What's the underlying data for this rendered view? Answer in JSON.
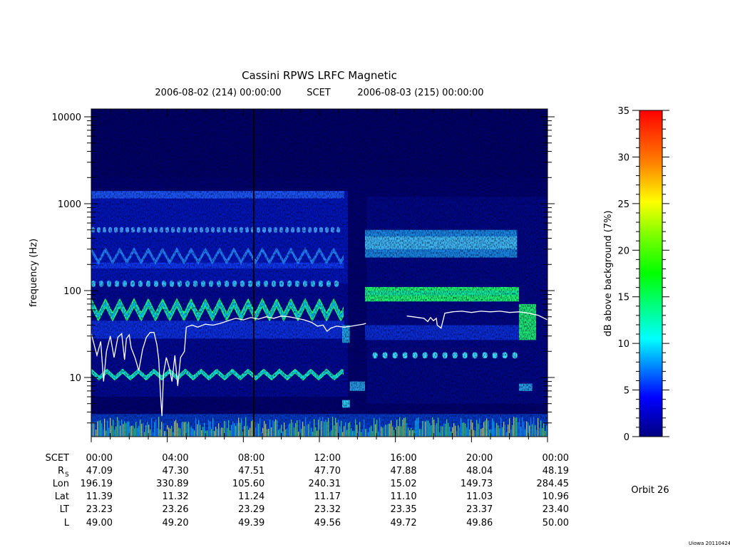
{
  "chart_data": {
    "type": "heatmap",
    "title": "Cassini RPWS LRFC Magnetic",
    "subtitle": {
      "start": "2006-08-02 (214) 00:00:00",
      "frame": "SCET",
      "end": "2006-08-03 (215) 00:00:00"
    },
    "ylabel": "frequency (Hz)",
    "y_scale": "log",
    "y_ticks": [
      {
        "value": 10,
        "label": "10"
      },
      {
        "value": 100,
        "label": "100"
      },
      {
        "value": 1000,
        "label": "1000"
      },
      {
        "value": 10000,
        "label": "10000"
      }
    ],
    "ylim": [
      2,
      12000
    ],
    "x_ticks": [
      "00:00",
      "04:00",
      "08:00",
      "12:00",
      "16:00",
      "20:00",
      "00:00"
    ],
    "xlim_hours": [
      0,
      24
    ],
    "colorbar": {
      "label": "dB above background (7%)",
      "ticks": [
        0,
        5,
        10,
        15,
        20,
        25,
        30,
        35
      ],
      "range": [
        0,
        35
      ]
    },
    "overlay_line": {
      "color": "#ffffff",
      "points": [
        [
          0.0,
          32
        ],
        [
          0.3,
          18
        ],
        [
          0.5,
          26
        ],
        [
          0.65,
          9
        ],
        [
          0.8,
          20
        ],
        [
          1.0,
          30
        ],
        [
          1.2,
          17
        ],
        [
          1.4,
          29
        ],
        [
          1.6,
          32
        ],
        [
          1.75,
          16
        ],
        [
          1.85,
          28
        ],
        [
          2.0,
          31
        ],
        [
          2.1,
          22
        ],
        [
          2.3,
          17
        ],
        [
          2.5,
          12
        ],
        [
          2.7,
          21
        ],
        [
          2.9,
          29
        ],
        [
          3.1,
          33
        ],
        [
          3.3,
          33
        ],
        [
          3.45,
          24
        ],
        [
          3.55,
          16
        ],
        [
          3.65,
          6
        ],
        [
          3.72,
          3.6
        ],
        [
          3.8,
          11
        ],
        [
          3.95,
          17
        ],
        [
          4.1,
          13
        ],
        [
          4.25,
          9
        ],
        [
          4.4,
          18
        ],
        [
          4.55,
          8
        ],
        [
          4.7,
          17
        ],
        [
          4.9,
          20
        ],
        [
          5.0,
          38
        ],
        [
          5.3,
          40
        ],
        [
          5.6,
          38
        ],
        [
          6.0,
          41
        ],
        [
          6.4,
          40
        ],
        [
          6.8,
          42
        ],
        [
          7.2,
          45
        ],
        [
          7.6,
          48
        ],
        [
          8.0,
          46
        ],
        [
          8.4,
          49
        ],
        [
          8.8,
          47
        ],
        [
          9.2,
          50
        ],
        [
          9.6,
          48
        ],
        [
          10.0,
          51
        ],
        [
          10.4,
          50
        ],
        [
          10.8,
          48
        ],
        [
          11.2,
          46
        ],
        [
          11.6,
          43
        ],
        [
          11.9,
          39
        ],
        [
          12.2,
          40
        ],
        [
          12.4,
          34
        ],
        [
          12.6,
          37
        ],
        [
          12.9,
          39
        ],
        [
          13.3,
          38
        ],
        [
          13.7,
          39
        ],
        [
          14.0,
          40
        ],
        [
          14.3,
          41
        ],
        [
          14.45,
          42
        ],
        [
          16.6,
          51
        ],
        [
          16.9,
          50
        ],
        [
          17.2,
          49
        ],
        [
          17.5,
          48
        ],
        [
          17.7,
          44
        ],
        [
          17.85,
          49
        ],
        [
          18.0,
          45
        ],
        [
          18.15,
          48
        ],
        [
          18.2,
          40
        ],
        [
          18.4,
          37
        ],
        [
          18.6,
          55
        ],
        [
          19.0,
          57
        ],
        [
          19.5,
          58
        ],
        [
          20.0,
          56
        ],
        [
          20.5,
          58
        ],
        [
          21.0,
          57
        ],
        [
          21.5,
          58
        ],
        [
          22.0,
          56
        ],
        [
          22.5,
          57
        ],
        [
          23.0,
          55
        ],
        [
          23.5,
          52
        ],
        [
          24.0,
          46
        ]
      ]
    }
  },
  "ephemeris": {
    "row_labels": [
      "SCET",
      "R",
      "Lon",
      "Lat",
      "LT",
      "L"
    ],
    "r_subscript": "S",
    "columns": [
      [
        "00:00",
        "47.09",
        "196.19",
        "11.39",
        "23.23",
        "49.00"
      ],
      [
        "04:00",
        "47.30",
        "330.89",
        "11.32",
        "23.26",
        "49.20"
      ],
      [
        "08:00",
        "47.51",
        "105.60",
        "11.24",
        "23.29",
        "49.39"
      ],
      [
        "12:00",
        "47.70",
        "240.31",
        "11.17",
        "23.32",
        "49.56"
      ],
      [
        "16:00",
        "47.88",
        "15.02",
        "11.10",
        "23.35",
        "49.72"
      ],
      [
        "20:00",
        "48.04",
        "149.73",
        "11.03",
        "23.37",
        "49.86"
      ],
      [
        "00:00",
        "48.19",
        "284.45",
        "10.96",
        "23.40",
        "50.00"
      ]
    ]
  },
  "orbit_label": "Orbit 26",
  "credit": "Uiowa 20110424"
}
